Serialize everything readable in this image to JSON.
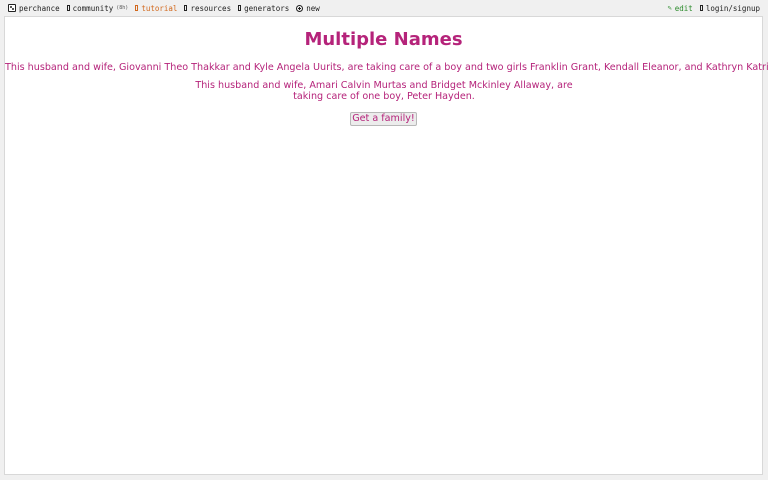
{
  "nav": {
    "left": [
      {
        "label": "perchance",
        "icon": "dice-icon"
      },
      {
        "label": "community",
        "badge": "(8h)",
        "icon": "chat-icon"
      },
      {
        "label": "tutorial",
        "icon": "book-icon"
      },
      {
        "label": "resources",
        "icon": "resources-icon"
      },
      {
        "label": "generators",
        "icon": "generators-icon"
      },
      {
        "label": "new",
        "icon": "plus-circle-icon"
      }
    ],
    "right": [
      {
        "label": "edit",
        "icon": "pencil-icon"
      },
      {
        "label": "login/signup",
        "icon": "user-icon"
      }
    ]
  },
  "main": {
    "title": "Multiple Names",
    "paragraph1": "This husband and wife, Giovanni Theo Thakkar and Kyle Angela Uurits, are taking care of a boy and two girls Franklin Grant, Kendall Eleanor, and Kathryn Katrina.",
    "paragraph2": "This husband and wife, Amari Calvin Murtas and Bridget Mckinley Allaway, are taking care of one boy, Peter Hayden.",
    "button_label": "Get a family!"
  },
  "colors": {
    "accent": "#b5237a",
    "tutorial": "#d2691e",
    "edit": "#2a8a2a"
  }
}
